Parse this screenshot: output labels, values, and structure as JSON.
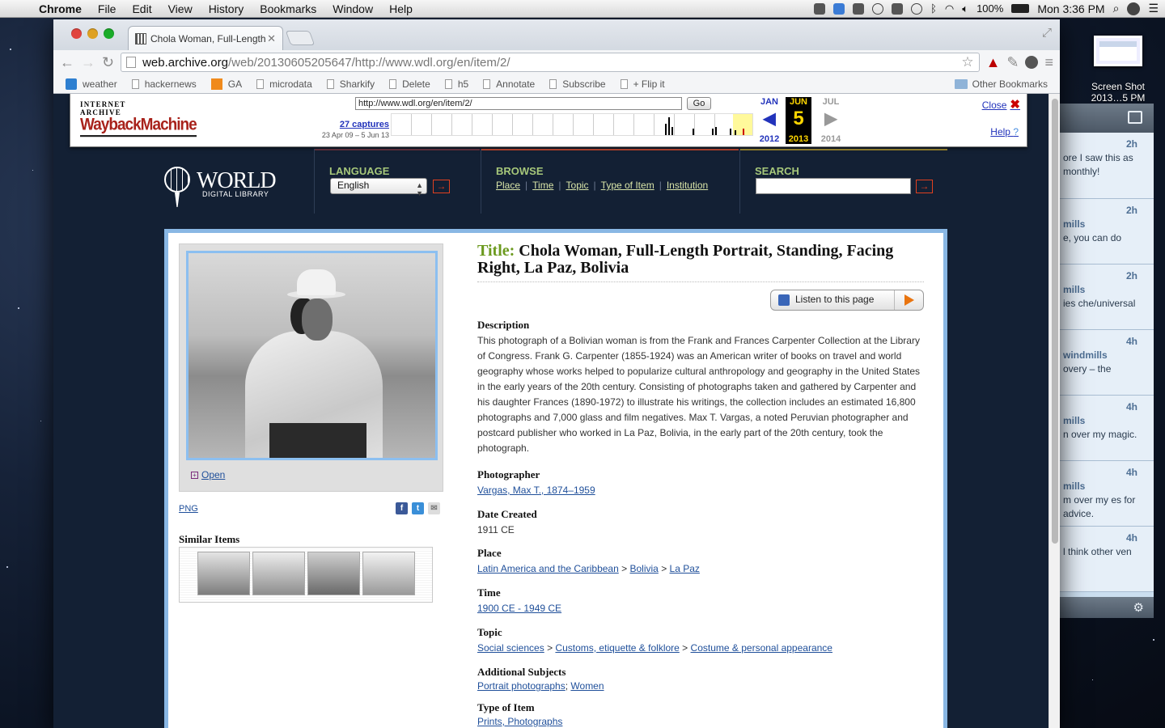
{
  "menubar": {
    "apple_icon": "apple-icon",
    "items": [
      "Chrome",
      "File",
      "Edit",
      "View",
      "History",
      "Bookmarks",
      "Window",
      "Help"
    ],
    "battery": "100%",
    "clock": "Mon 3:36 PM"
  },
  "desktop": {
    "screenshot_label": "Screen Shot 2013…5 PM"
  },
  "twitter_panel": {
    "tweets": [
      {
        "time": "2h",
        "user": "",
        "text": "ore I saw this as monthly!"
      },
      {
        "time": "2h",
        "user": "mills",
        "text": "e, you can do"
      },
      {
        "time": "2h",
        "user": "mills",
        "text": "ies che/universal"
      },
      {
        "time": "4h",
        "user": "windmills",
        "text": "overy – the"
      },
      {
        "time": "4h",
        "user": "mills",
        "text": "n over my magic."
      },
      {
        "time": "4h",
        "user": "mills",
        "text": "m over my es for advice."
      },
      {
        "time": "4h",
        "user": "",
        "text": "l think other ven"
      }
    ]
  },
  "browser": {
    "tab_title": "Chola Woman, Full-Length",
    "url_domain": "web.archive.org",
    "url_path": "/web/20130605205647/http://www.wdl.org/en/item/2/",
    "bookmarks": [
      "weather",
      "hackernews",
      "GA",
      "microdata",
      "Sharkify",
      "Delete",
      "h5",
      "Annotate",
      "Subscribe",
      "+ Flip it"
    ],
    "other_bookmarks": "Other Bookmarks"
  },
  "wayback": {
    "logo_top": "INTERNET ARCHIVE",
    "logo_main": "WaybackMachine",
    "url": "http://www.wdl.org/en/item/2/",
    "go": "Go",
    "captures": "27 captures",
    "range": "23 Apr 09 – 5 Jun 13",
    "prev_month": "JAN",
    "cur_month": "JUN",
    "next_month": "JUL",
    "day": "5",
    "prev_year": "2012",
    "cur_year": "2013",
    "next_year": "2014",
    "close": "Close",
    "help": "Help"
  },
  "wdl": {
    "logo_world": "WORLD",
    "logo_sub": "DIGITAL LIBRARY",
    "language_label": "LANGUAGE",
    "language_value": "English",
    "browse_label": "BROWSE",
    "browse_links": [
      "Place",
      "Time",
      "Topic",
      "Type of Item",
      "Institution"
    ],
    "search_label": "SEARCH"
  },
  "item": {
    "title_label": "Title:",
    "title": "Chola Woman, Full-Length Portrait, Standing, Facing Right, La Paz, Bolivia",
    "listen": "Listen to this page",
    "open": "Open",
    "png": "PNG",
    "similar_items": "Similar Items",
    "description_h": "Description",
    "description": "This photograph of a Bolivian woman is from the Frank and Frances Carpenter Collection at the Library of Congress. Frank G. Carpenter (1855-1924) was an American writer of books on travel and world geography whose works helped to popularize cultural anthropology and geography in the United States in the early years of the 20th century. Consisting of photographs taken and gathered by Carpenter and his daughter Frances (1890-1972) to illustrate his writings, the collection includes an estimated 16,800 photographs and 7,000 glass and film negatives. Max T. Vargas, a noted Peruvian photographer and postcard publisher who worked in La Paz, Bolivia, in the early part of the 20th century, took the photograph.",
    "photographer_h": "Photographer",
    "photographer": "Vargas, Max T., 1874–1959",
    "date_h": "Date Created",
    "date": "1911 CE",
    "place_h": "Place",
    "place": [
      "Latin America and the Caribbean",
      "Bolivia",
      "La Paz"
    ],
    "time_h": "Time",
    "time": "1900 CE - 1949 CE",
    "topic_h": "Topic",
    "topic": [
      "Social sciences",
      "Customs, etiquette & folklore",
      "Costume & personal appearance"
    ],
    "subjects_h": "Additional Subjects",
    "subjects": [
      "Portrait photographs",
      "Women"
    ],
    "type_h": "Type of Item",
    "type": "Prints, Photographs"
  }
}
